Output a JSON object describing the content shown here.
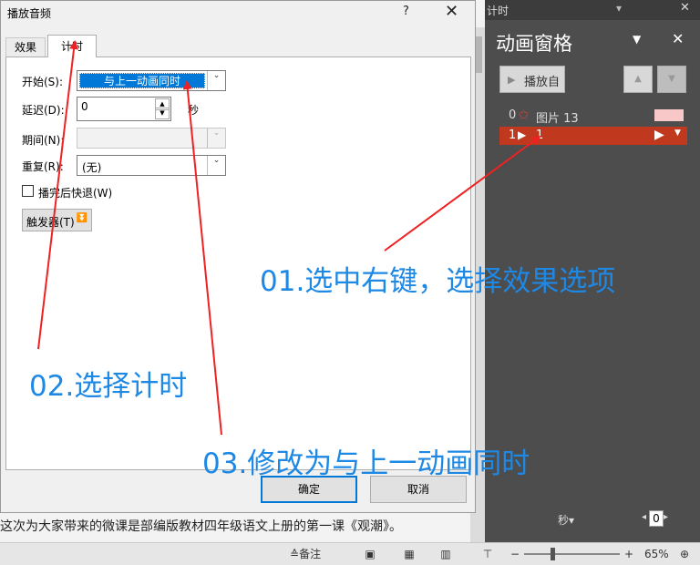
{
  "dialog": {
    "title": "播放音频",
    "help": "?",
    "close": "✕",
    "tabs": [
      "效果",
      "计时"
    ],
    "fields": {
      "start_label": "开始(S):",
      "start_value": "与上一动画同时",
      "delay_label": "延迟(D):",
      "delay_value": "0",
      "delay_unit": "秒",
      "duration_label": "期间(N):",
      "duration_value": "",
      "repeat_label": "重复(R):",
      "repeat_value": "(无)",
      "rewind_label": "播完后快退(W)",
      "triggers_label": "触发器(T)"
    },
    "ok": "确定",
    "cancel": "取消"
  },
  "pane": {
    "topbar_title": "计时",
    "title": "动画窗格",
    "play_from": "播放自",
    "items": [
      {
        "num": "0",
        "label": "图片 13"
      },
      {
        "num": "1",
        "label": "1"
      }
    ],
    "seconds_label": "秒",
    "zoom_value": "0"
  },
  "slide": {
    "caption": "这次为大家带来的微课是部编版教材四年级语文上册的第一课《观潮》。"
  },
  "statusbar": {
    "notes": "备注",
    "zoom_level": "65%",
    "minus": "−",
    "plus": "+"
  },
  "annotations": {
    "step1": "01.选中右键，选择效果选项",
    "step2": "02.选择计时",
    "step3": "03.修改为与上一动画同时"
  },
  "colors": {
    "accent": "#0078d7",
    "annotation": "#1e88e5",
    "arrow": "#ee2222",
    "selected_row": "#c0391f"
  }
}
